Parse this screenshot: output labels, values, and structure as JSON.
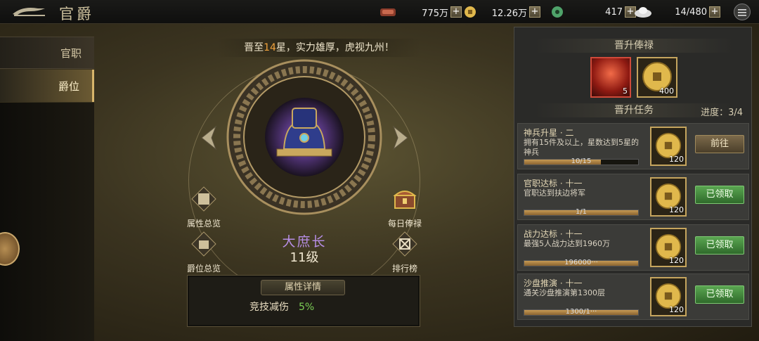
{
  "header": {
    "title": "官爵",
    "resources": [
      {
        "icon": "token-icon",
        "value": "775万"
      },
      {
        "icon": "gold-coin-icon",
        "value": "12.26万"
      },
      {
        "icon": "jade-icon",
        "value": "417"
      },
      {
        "icon": "silver-ingot-icon",
        "value": "14/480"
      }
    ]
  },
  "sidebar": {
    "items": [
      {
        "label": "官职",
        "active": false
      },
      {
        "label": "爵位",
        "active": true
      }
    ]
  },
  "main": {
    "slogan_prefix": "晋至",
    "slogan_star": "14",
    "slogan_suffix": "星，实力雄厚，虎视九州！",
    "functions": [
      "属性总览",
      "每日俸禄",
      "爵位总览",
      "排行榜"
    ],
    "rank_name": "大庶长",
    "rank_level": "11级",
    "attr_title": "属性详情",
    "attr_label": "竞技减伤",
    "attr_value": "5%"
  },
  "panel": {
    "salary_title": "晋升俸禄",
    "rewards": [
      {
        "icon": "red-orb-icon",
        "count": "5"
      },
      {
        "icon": "gold-coin-icon",
        "count": "400"
      }
    ],
    "task_title": "晋升任务",
    "progress": "进度：3/4",
    "tasks": [
      {
        "title": "神兵升星 · 二",
        "desc": "拥有15件及以上，星数达到5星的神兵",
        "progress_text": "10/15",
        "progress": 0.67,
        "reward": "120",
        "button": "前往",
        "state": "go"
      },
      {
        "title": "官职达标 · 十一",
        "desc": "官职达到扶边将军",
        "progress_text": "1/1",
        "progress": 1.0,
        "reward": "120",
        "button": "已领取",
        "state": "claimed"
      },
      {
        "title": "战力达标 · 十一",
        "desc": "最强5人战力达到1960万",
        "progress_text": "196000···",
        "progress": 1.0,
        "reward": "120",
        "button": "已领取",
        "state": "claimed"
      },
      {
        "title": "沙盘推演 · 十一",
        "desc": "通关沙盘推演第1300层",
        "progress_text": "1300/1···",
        "progress": 1.0,
        "reward": "120",
        "button": "已领取",
        "state": "claimed"
      }
    ]
  },
  "colors": {
    "accent_gold": "#d7b56b",
    "claimed_green": "#4f9a47",
    "rank_purple": "#b78ee6",
    "highlight_orange": "#f2a23c"
  }
}
